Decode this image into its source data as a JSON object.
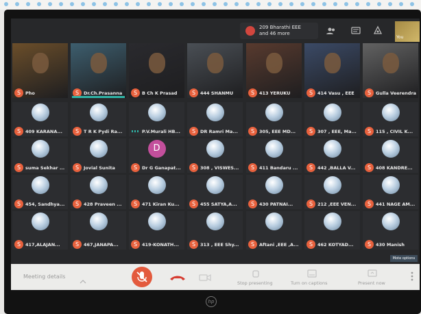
{
  "meeting": {
    "notification": {
      "line1": "209 Bharathi EEE",
      "line2": "and 46 more"
    },
    "toolbar_icons": [
      "people-icon",
      "chat-icon",
      "activities-icon"
    ],
    "you_label": "You",
    "participants": [
      {
        "name": "Pho",
        "letter": "S"
      },
      {
        "name": "Dr.Ch.Prasanna",
        "letter": "S"
      },
      {
        "name": "B Ch K Prasad",
        "letter": "S"
      },
      {
        "name": "444 SHANMU",
        "letter": "S"
      },
      {
        "name": "413 YERUKU",
        "letter": "S"
      },
      {
        "name": "414 Vasu , EEE",
        "letter": "S"
      },
      {
        "name": "Gulla Veerendra",
        "letter": "S"
      },
      {
        "name": "409 KARANA...",
        "letter": "S"
      },
      {
        "name": "T R K Pydi Ra...",
        "letter": "S"
      },
      {
        "name": "P.V.Murali HB...",
        "letter": ""
      },
      {
        "name": "DR Ramri Ma...",
        "letter": "S"
      },
      {
        "name": "305, EEE MD...",
        "letter": "S"
      },
      {
        "name": "307 , EEE, Ma...",
        "letter": "S"
      },
      {
        "name": "115 , CIVIL K...",
        "letter": "S"
      },
      {
        "name": "suma Sekhar ...",
        "letter": "S"
      },
      {
        "name": "Jovial Sunita",
        "letter": "S"
      },
      {
        "name": "Dr G Ganapat...",
        "letter": "S"
      },
      {
        "name": "308 , VISWES...",
        "letter": "S"
      },
      {
        "name": "411 Bandaru ...",
        "letter": "S"
      },
      {
        "name": "442 ,BALLA V...",
        "letter": "S"
      },
      {
        "name": "408 KANDRE...",
        "letter": "S"
      },
      {
        "name": "454, Sandhya...",
        "letter": "S"
      },
      {
        "name": "428 Praveen ...",
        "letter": "S"
      },
      {
        "name": "471 Kiran Ku...",
        "letter": "S"
      },
      {
        "name": "455 SATYA,A...",
        "letter": "S"
      },
      {
        "name": "430 PATNAI...",
        "letter": "S"
      },
      {
        "name": "212 ,EEE VEN...",
        "letter": "S"
      },
      {
        "name": "441 NAGE AM...",
        "letter": "S"
      },
      {
        "name": "417,ALAJAN...",
        "letter": "S"
      },
      {
        "name": "467,JANAPA...",
        "letter": "S"
      },
      {
        "name": "419-KONATH...",
        "letter": "S"
      },
      {
        "name": "313 , EEE Shy...",
        "letter": "S"
      },
      {
        "name": "Aftani ,EEE ,A...",
        "letter": "S"
      },
      {
        "name": "462 KOTYAD...",
        "letter": "S"
      },
      {
        "name": "430 Manish",
        "letter": "S"
      }
    ],
    "dg_letter": "D",
    "bottom": {
      "meeting_details": "Meeting details",
      "labels": [
        "Stop presenting",
        "Turn on captions",
        "Present now"
      ]
    },
    "more_label": "Mote options",
    "hp_logo": "hp"
  }
}
